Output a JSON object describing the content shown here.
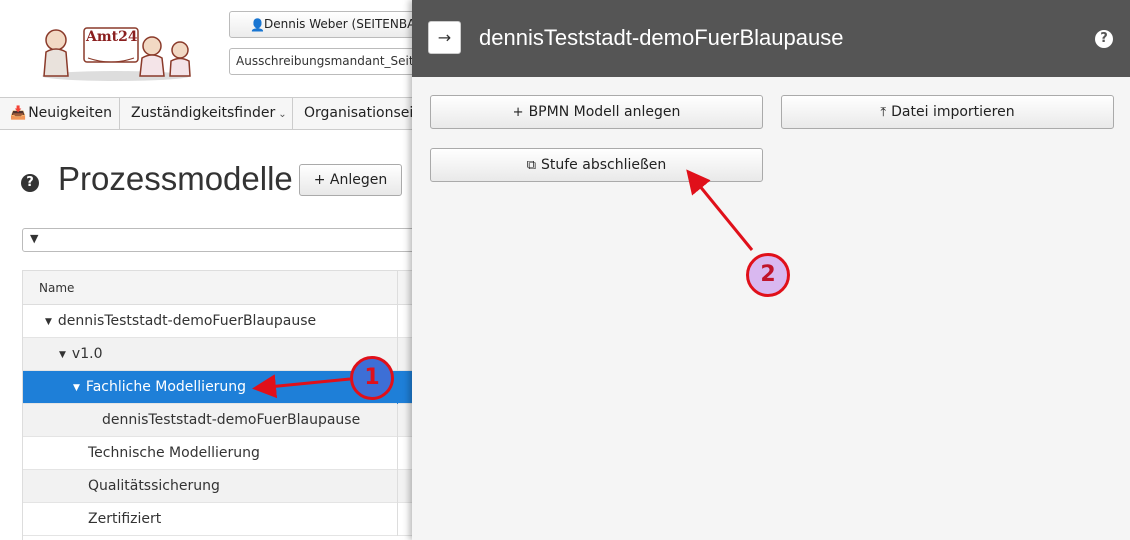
{
  "header": {
    "logo_text": "Amt24",
    "user_label": "Dennis Weber (SEITENBAU GmbH)",
    "mandant_value": "Ausschreibungsmandant_Seitenbau"
  },
  "nav": {
    "items": [
      {
        "label": "Neuigkeiten"
      },
      {
        "label": "Zuständigkeitsfinder"
      },
      {
        "label": "Organisationseinheiten"
      }
    ]
  },
  "page": {
    "title": "Prozessmodelle",
    "anlegen_label": "Anlegen",
    "filter_value": ""
  },
  "tree": {
    "column_name": "Name",
    "rows": [
      {
        "label": "dennisTeststadt-demoFuerBlaupause",
        "expanded": true
      },
      {
        "label": "v1.0",
        "expanded": true
      },
      {
        "label": "Fachliche Modellierung",
        "expanded": true,
        "selected": true
      },
      {
        "label": "dennisTeststadt-demoFuerBlaupause"
      },
      {
        "label": "Technische Modellierung"
      },
      {
        "label": "Qualitätssicherung"
      },
      {
        "label": "Zertifiziert"
      }
    ]
  },
  "panel": {
    "title": "dennisTeststadt-demoFuerBlaupause",
    "bpmn_label": "BPMN Modell anlegen",
    "import_label": "Datei importieren",
    "stufe_label": "Stufe abschließen"
  },
  "annotations": {
    "badge_1": "1",
    "badge_2": "2",
    "color": "#e0101a"
  }
}
